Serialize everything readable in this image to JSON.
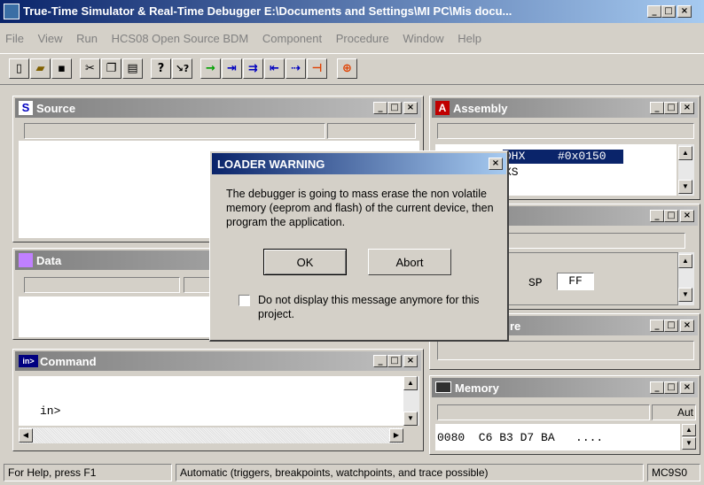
{
  "app": {
    "title": "True-Time Simulator & Real-Time Debugger   E:\\Documents and Settings\\MI PC\\Mis docu..."
  },
  "menu": [
    "File",
    "View",
    "Run",
    "HCS08 Open Source BDM",
    "Component",
    "Procedure",
    "Window",
    "Help"
  ],
  "toolbar": {
    "help_glyph": "?",
    "context_help_glyph": "↘?"
  },
  "windows": {
    "source": {
      "title": "Source"
    },
    "assembly": {
      "title": "Assembly",
      "lines": [
        {
          "mnemonic": "DHX",
          "operand": "#0x0150"
        },
        {
          "mnemonic": "XS",
          "operand": ""
        }
      ]
    },
    "register": {
      "sp_label": "SP",
      "sp_value": "FF"
    },
    "data": {
      "title": "Data"
    },
    "procedure": {
      "title_suffix": "re"
    },
    "command": {
      "title": "Command",
      "prompt": "in>"
    },
    "memory": {
      "title": "Memory",
      "auto_label": "Aut",
      "row": "0080  C6 B3 D7 BA   ...."
    }
  },
  "dialog": {
    "title": "LOADER WARNING",
    "message": "The debugger is going to mass erase the non volatile memory (eeprom and flash) of the current device, then program the application.",
    "ok_label": "OK",
    "abort_label": "Abort",
    "checkbox_label": "Do not display this message anymore for this project.",
    "checkbox_checked": false
  },
  "statusbar": {
    "help": "For Help, press F1",
    "mode": "Automatic (triggers, breakpoints, watchpoints, and trace possible)",
    "target": "MC9S0"
  }
}
